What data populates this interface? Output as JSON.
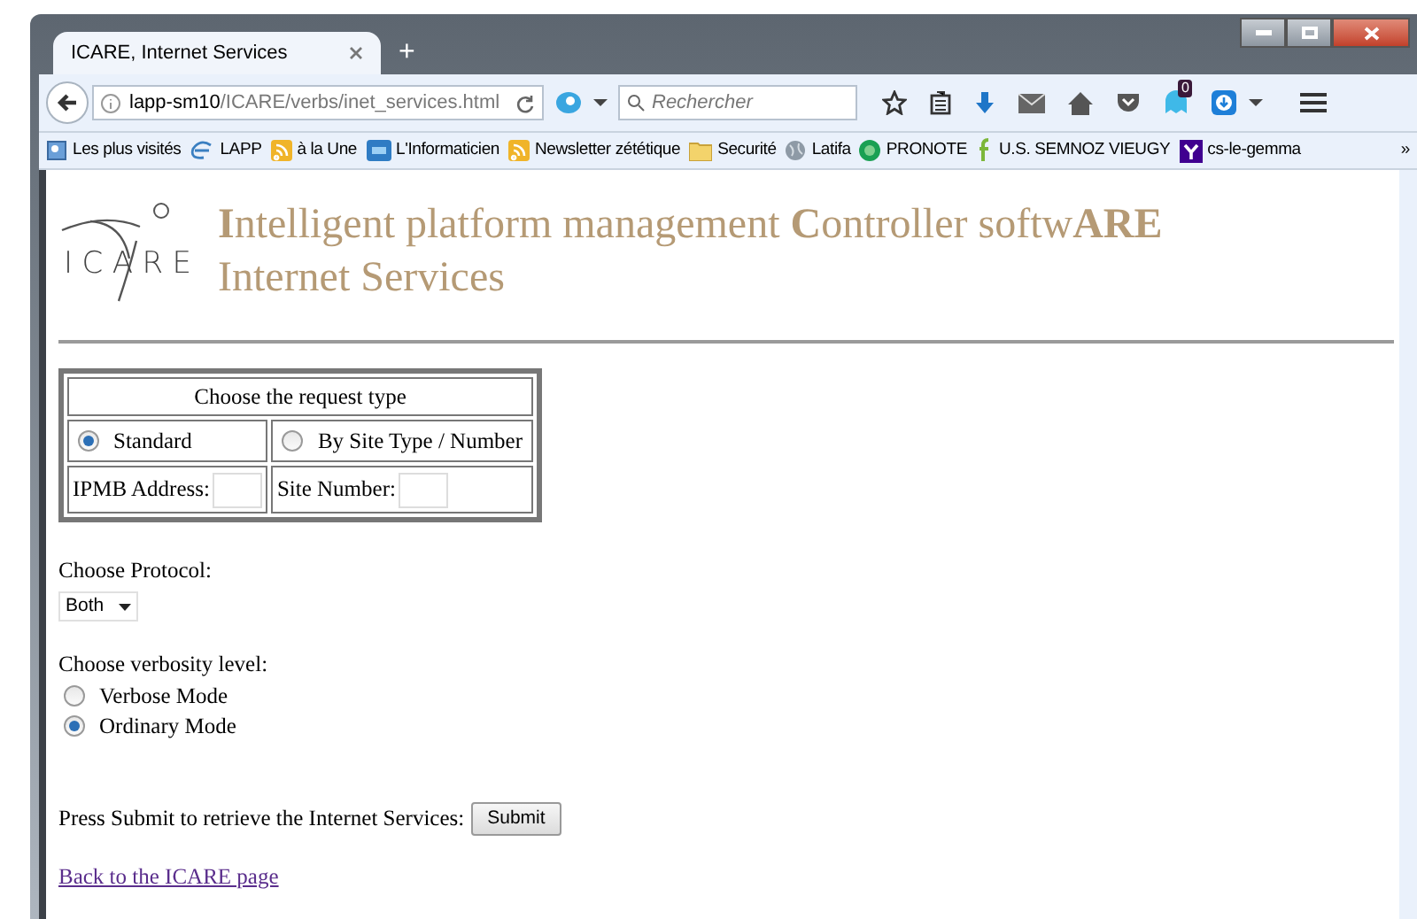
{
  "window": {
    "tab_title": "ICARE, Internet Services",
    "new_tab": "+"
  },
  "nav": {
    "url_host": "lapp-sm10",
    "url_path": "/ICARE/verbs/inet_services.html",
    "search_placeholder": "Rechercher",
    "badge": "0"
  },
  "bookmarks": [
    {
      "label": "Les plus visités",
      "kind": "page"
    },
    {
      "label": "LAPP",
      "kind": "e"
    },
    {
      "label": "à la Une",
      "kind": "rss"
    },
    {
      "label": "L'Informaticien",
      "kind": "blue"
    },
    {
      "label": "Newsletter zététique",
      "kind": "rss"
    },
    {
      "label": "Securité",
      "kind": "folder"
    },
    {
      "label": "Latifa",
      "kind": "globe"
    },
    {
      "label": "PRONOTE",
      "kind": "green"
    },
    {
      "label": "U.S. SEMNOZ VIEUGY",
      "kind": "f"
    },
    {
      "label": "cs-le-gemma",
      "kind": "y"
    }
  ],
  "bookmarks_more": "»",
  "page": {
    "logo_letters": [
      "I",
      "C",
      "A",
      "R",
      "E"
    ],
    "heading": [
      "**I**ntelligent platform management **C**ontroller softw**ARE**",
      "Internet Services"
    ],
    "table": {
      "title": "Choose the request type",
      "options": [
        {
          "label": "Standard",
          "selected": true
        },
        {
          "label": "By Site Type / Number",
          "selected": false
        }
      ],
      "fields": [
        {
          "label": "IPMB Address:"
        },
        {
          "label": "Site Number:"
        }
      ]
    },
    "protocol_label": "Choose Protocol:",
    "protocol_value": "Both",
    "verbosity_label": "Choose verbosity level:",
    "verbosity": [
      {
        "label": "Verbose Mode",
        "selected": false
      },
      {
        "label": "Ordinary Mode",
        "selected": true
      }
    ],
    "submit_text": "Press Submit to retrieve the Internet Services:",
    "submit_button": "Submit",
    "back_link": "Back to the ICARE page"
  }
}
